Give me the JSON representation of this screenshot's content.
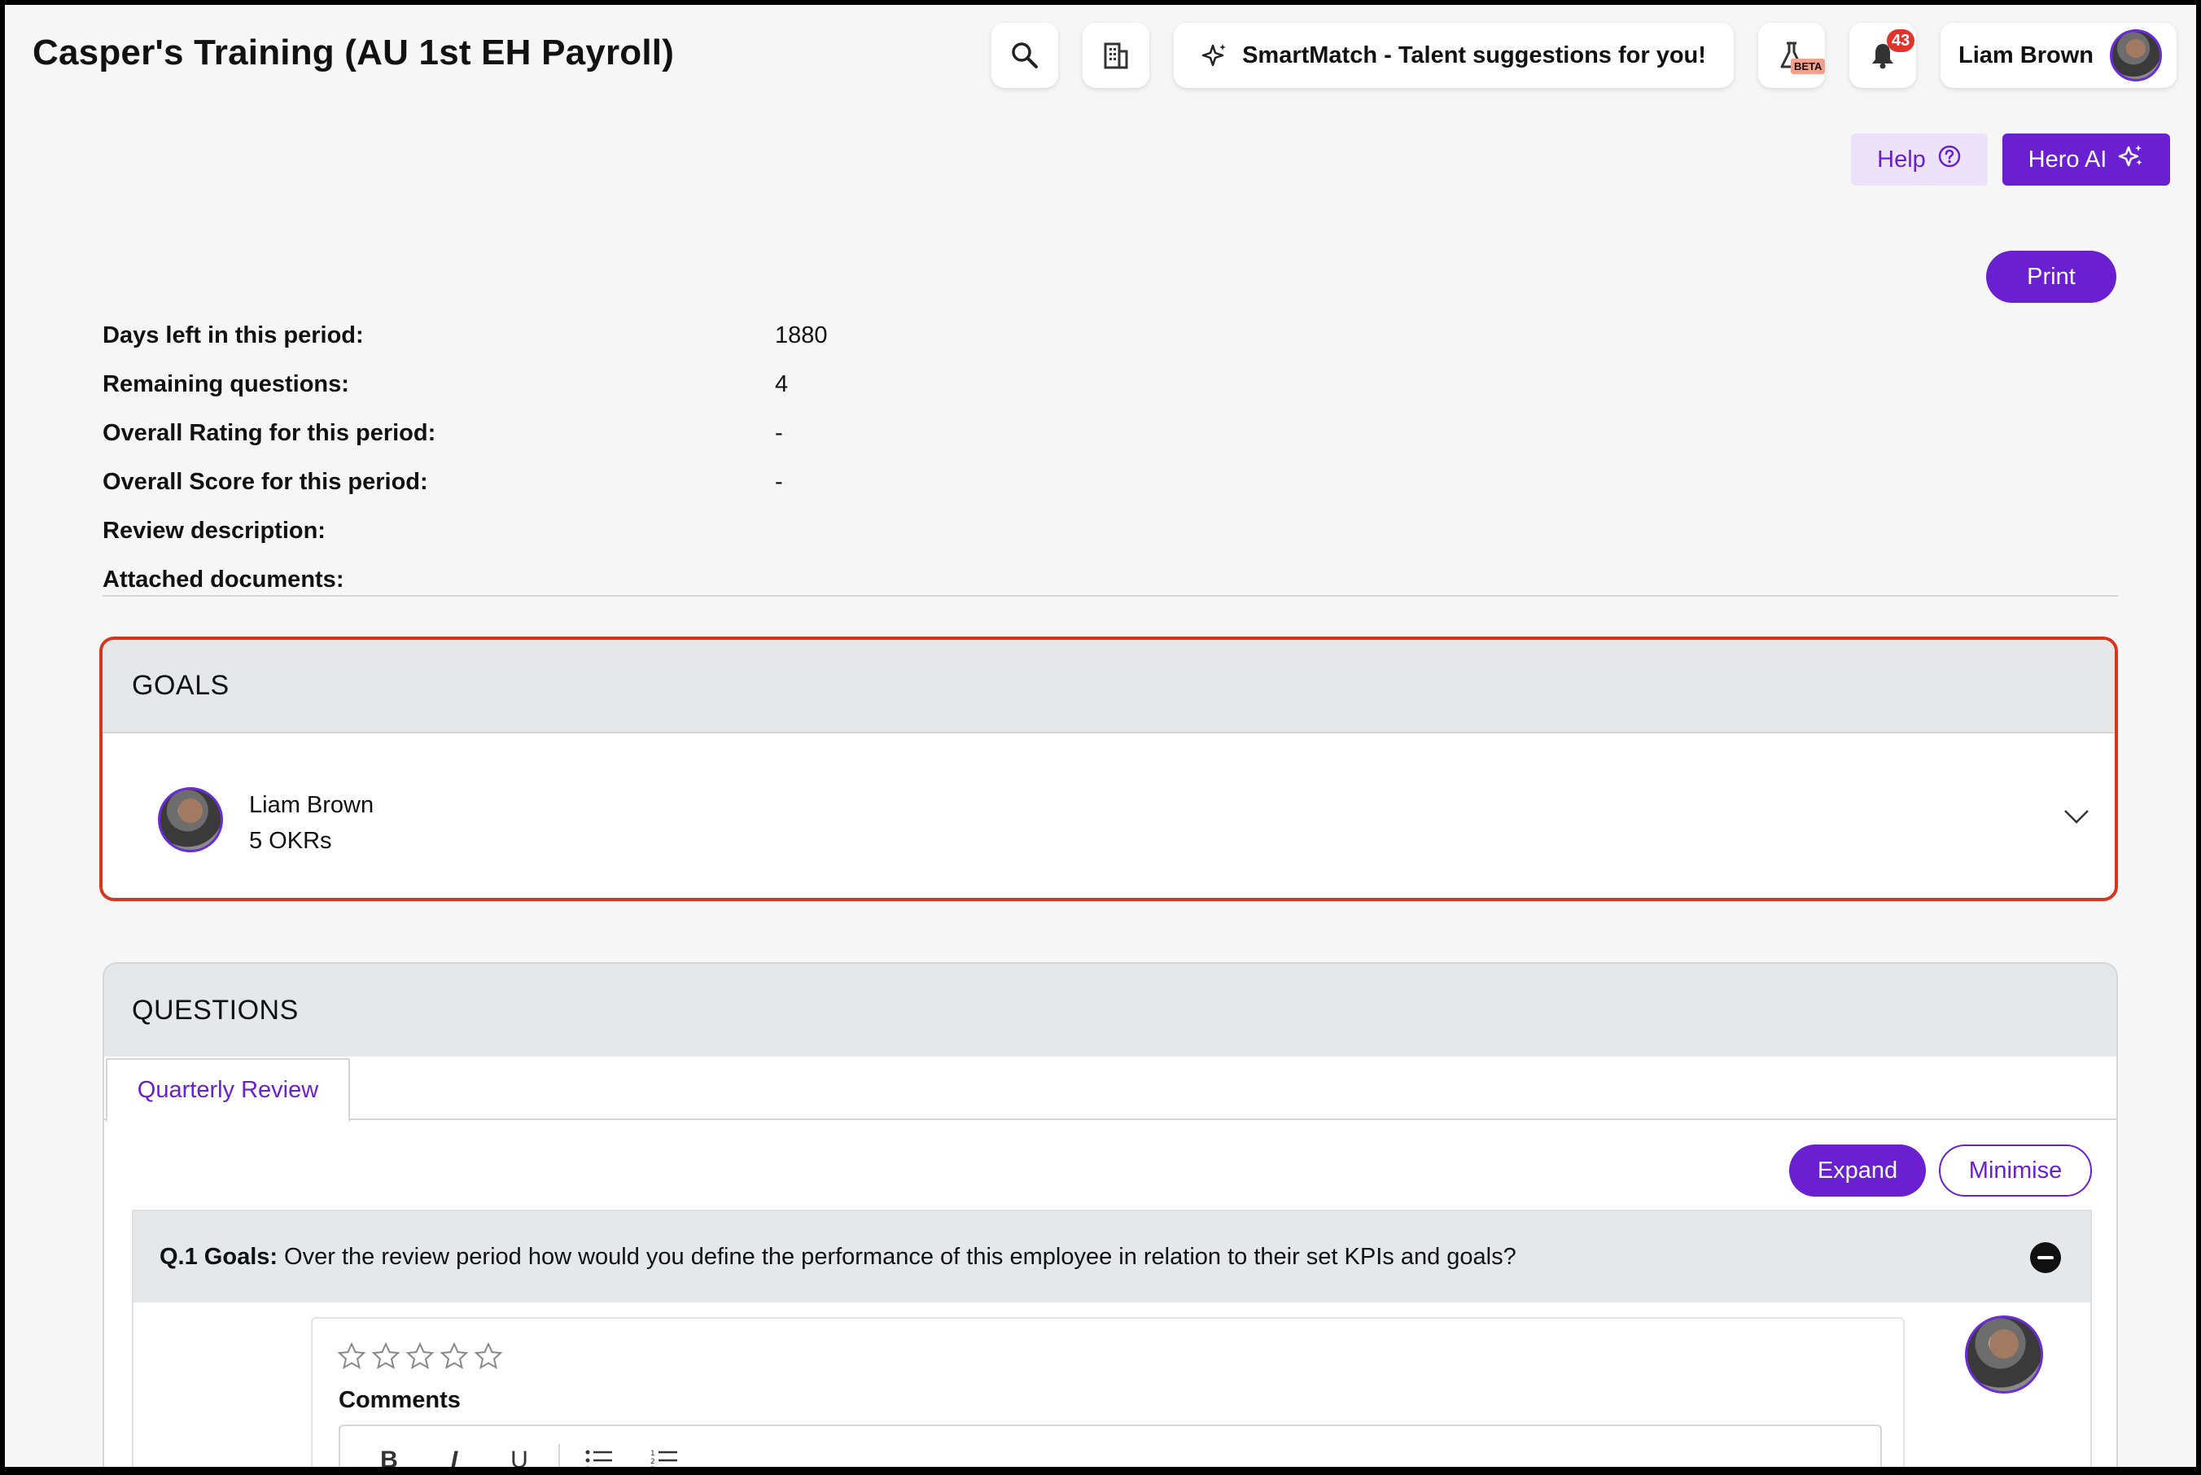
{
  "header": {
    "title": "Casper's Training (AU 1st EH Payroll)",
    "smartmatch_label": "SmartMatch - Talent suggestions for you!",
    "beta_label": "BETA",
    "notification_count": "43",
    "user_name": "Liam Brown",
    "icons": [
      "search-icon",
      "building-icon",
      "sparkle-icon",
      "flask-icon",
      "bell-icon"
    ]
  },
  "actions": {
    "help_label": "Help",
    "hero_ai_label": "Hero AI",
    "print_label": "Print"
  },
  "info": {
    "rows": [
      {
        "label": "Days left in this period:",
        "value": "1880"
      },
      {
        "label": "Remaining questions:",
        "value": "4"
      },
      {
        "label": "Overall Rating for this period:",
        "value": "-"
      },
      {
        "label": "Overall Score for this period:",
        "value": "-"
      },
      {
        "label": "Review description:",
        "value": ""
      },
      {
        "label": "Attached documents:",
        "value": ""
      }
    ]
  },
  "goals": {
    "heading": "GOALS",
    "owner_name": "Liam Brown",
    "okr_count": "5 OKRs"
  },
  "questions": {
    "heading": "QUESTIONS",
    "tab_label": "Quarterly Review",
    "expand_label": "Expand",
    "minimise_label": "Minimise",
    "q1_prefix": "Q.1 Goals:",
    "q1_text": "Over the review period how would you define the performance of this employee in relation to their set KPIs and goals?",
    "rating_stars": 5,
    "rating_value": 0,
    "comments_label": "Comments",
    "toolbar": {
      "bold": "B",
      "italic": "I",
      "underline": "U"
    }
  },
  "colors": {
    "accent": "#6a1fd1",
    "highlight_border": "#d9341c",
    "badge": "#e0342a"
  }
}
